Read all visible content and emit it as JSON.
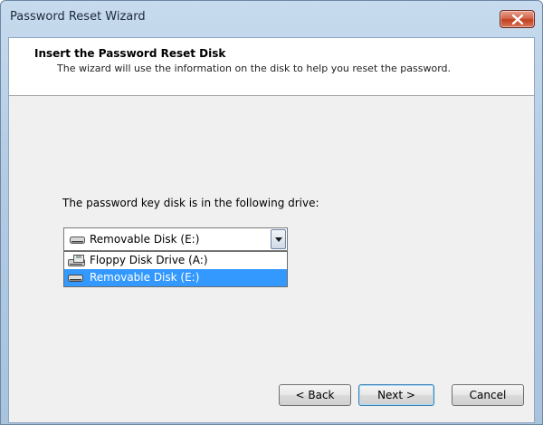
{
  "window": {
    "title": "Password Reset Wizard"
  },
  "header": {
    "title": "Insert the Password Reset Disk",
    "subtitle": "The wizard will use the information on the disk to help you reset the password."
  },
  "drive": {
    "label": "The password key disk is in the following drive:",
    "selected": "Removable Disk (E:)",
    "options": [
      {
        "label": "Floppy Disk Drive (A:)",
        "icon": "floppy-drive-icon",
        "highlighted": false
      },
      {
        "label": "Removable Disk (E:)",
        "icon": "removable-disk-icon",
        "highlighted": true
      }
    ]
  },
  "buttons": {
    "back": "< Back",
    "next": "Next >",
    "cancel": "Cancel"
  },
  "colors": {
    "selection": "#3399ff",
    "header_bg": "#ffffff",
    "client_bg": "#f0f0f0"
  }
}
